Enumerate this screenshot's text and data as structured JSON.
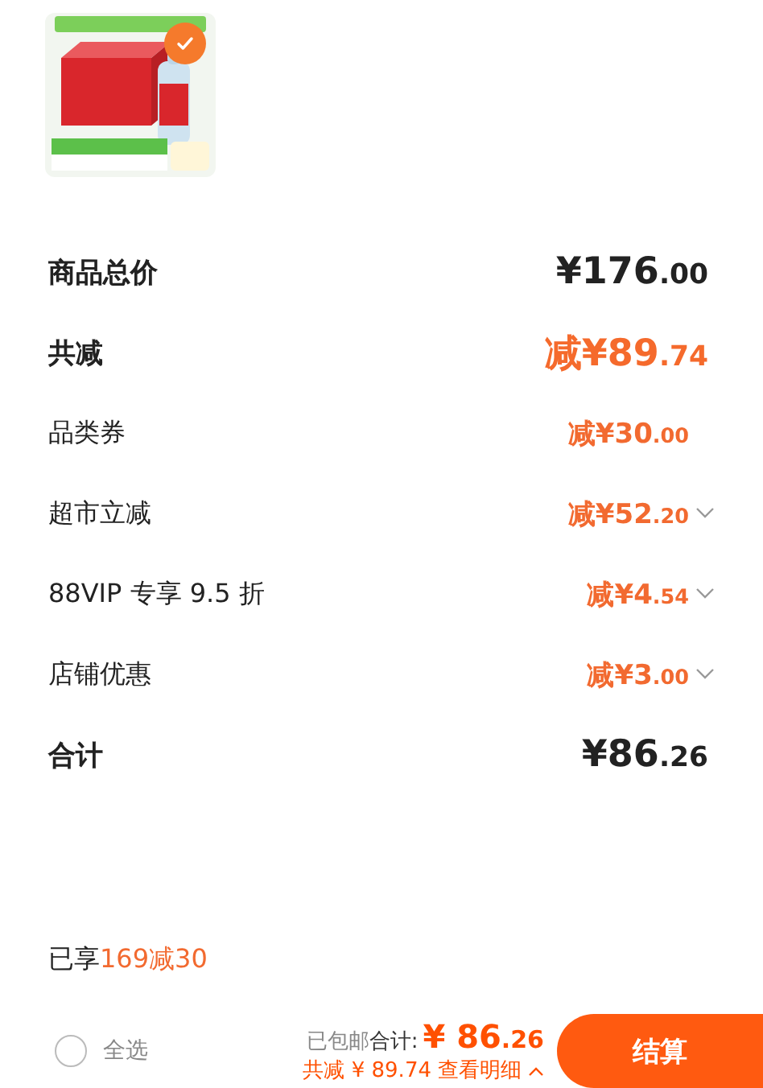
{
  "product": {
    "selected": true
  },
  "rows": [
    {
      "kind": "header",
      "label": "商品总价",
      "amount": "¥176.00",
      "discount": false,
      "expandable": false
    },
    {
      "kind": "header",
      "label": "共减",
      "amount": "减¥89.74",
      "discount": true,
      "expandable": false
    },
    {
      "kind": "detail",
      "label": "品类券",
      "amount": "减¥30.00",
      "discount": true,
      "expandable": false
    },
    {
      "kind": "detail",
      "label": "超市立减",
      "amount": "减¥52.20",
      "discount": true,
      "expandable": true
    },
    {
      "kind": "detail",
      "label": "88VIP 专享 9.5 折",
      "amount": "减¥4.54",
      "discount": true,
      "expandable": true
    },
    {
      "kind": "detail",
      "label": "店铺优惠",
      "amount": "减¥3.00",
      "discount": true,
      "expandable": true
    },
    {
      "kind": "header",
      "label": "合计",
      "amount": "¥86.26",
      "discount": false,
      "expandable": false
    }
  ],
  "promo": {
    "prefix": "已享",
    "highlight": "169减30"
  },
  "bottom_bar": {
    "select_all": {
      "label": "全选",
      "checked": false
    },
    "shipping": "已包邮",
    "total_label": "合计:",
    "total": "¥ 86.26",
    "savings": "共减 ¥ 89.74",
    "details_link": "查看明细",
    "checkout": "结算"
  }
}
